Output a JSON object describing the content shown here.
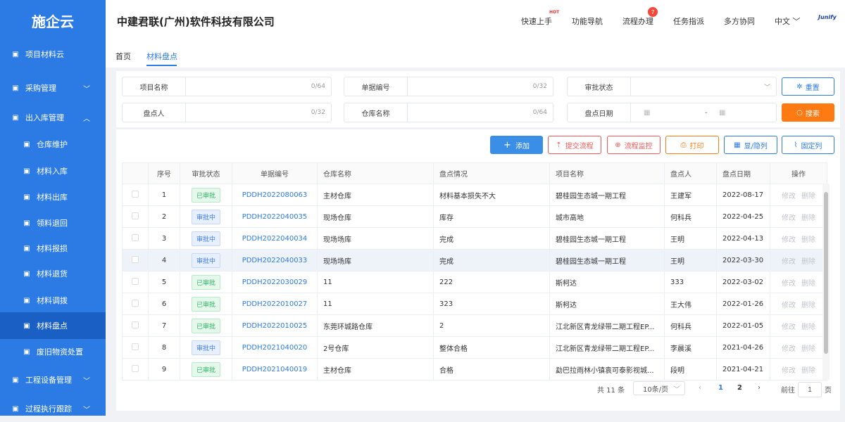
{
  "sidebar": {
    "logo": "施企云",
    "items": [
      {
        "label": "项目材料云",
        "icon": "grid-icon",
        "level": "top"
      },
      {
        "label": "采购管理",
        "icon": "people-icon",
        "level": "top",
        "chev": "﹀"
      },
      {
        "label": "出入库管理",
        "icon": "home-icon",
        "level": "top",
        "chev": "︿"
      },
      {
        "label": "仓库维护",
        "icon": "warehouse-icon",
        "level": "sub"
      },
      {
        "label": "材料入库",
        "icon": "inbound-icon",
        "level": "sub"
      },
      {
        "label": "材料出库",
        "icon": "outbound-icon",
        "level": "sub"
      },
      {
        "label": "领料退回",
        "icon": "return-icon",
        "level": "sub"
      },
      {
        "label": "材料报损",
        "icon": "damage-icon",
        "level": "sub"
      },
      {
        "label": "材料退货",
        "icon": "refund-icon",
        "level": "sub"
      },
      {
        "label": "材料调拨",
        "icon": "transfer-icon",
        "level": "sub"
      },
      {
        "label": "材料盘点",
        "icon": "inventory-icon",
        "level": "sub",
        "active": true
      },
      {
        "label": "废旧物资处置",
        "icon": "scrap-icon",
        "level": "sub"
      },
      {
        "label": "工程设备管理",
        "icon": "cube-icon",
        "level": "top",
        "chev": "﹀"
      },
      {
        "label": "过程执行跟踪",
        "icon": "track-icon",
        "level": "top",
        "chev": "﹀"
      }
    ]
  },
  "header": {
    "company": "中建君联(广州)软件科技有限公司",
    "nav": [
      "快速上手",
      "功能导航",
      "流程办理",
      "任务指派",
      "多方协同",
      "中文"
    ],
    "hot_label": "HOT",
    "process_badge": "7",
    "brand": "Junify"
  },
  "tabs": [
    "首页",
    "材料盘点"
  ],
  "filter": {
    "project_name": {
      "label": "项目名称",
      "count": "0/64"
    },
    "doc_no": {
      "label": "单据编号",
      "count": "0/32"
    },
    "approve_status": {
      "label": "审批状态"
    },
    "counter": {
      "label": "盘点人",
      "count": "0/32"
    },
    "warehouse": {
      "label": "仓库名称",
      "count": "0/64"
    },
    "date": {
      "label": "盘点日期",
      "sep": "-"
    },
    "reset": "重置",
    "search": "搜索"
  },
  "toolbar": {
    "add": "添加",
    "submit": "提交流程",
    "monitor": "流程监控",
    "print": "打印",
    "toggle_cols": "显/隐列",
    "pin_cols": "固定列"
  },
  "table": {
    "headers": [
      "序号",
      "审批状态",
      "单据编号",
      "仓库名称",
      "盘点情况",
      "项目名称",
      "盘点人",
      "盘点日期",
      "操作"
    ],
    "edit": "修改",
    "delete": "删除",
    "rows": [
      {
        "no": "1",
        "status": "已审批",
        "doc": "PDDH2022080063",
        "wh": "主材仓库",
        "cond": "材料基本损失不大",
        "proj": "碧桂园生态城一期工程",
        "person": "王建军",
        "date": "2022-08-17"
      },
      {
        "no": "2",
        "status": "审批中",
        "doc": "PDDH2022040035",
        "wh": "现场仓库",
        "cond": "库存",
        "proj": "城市高地",
        "person": "何科兵",
        "date": "2022-04-25"
      },
      {
        "no": "3",
        "status": "审批中",
        "doc": "PDDH2022040034",
        "wh": "现场场库",
        "cond": "完成",
        "proj": "碧桂园生态城一期工程",
        "person": "王明",
        "date": "2022-04-13"
      },
      {
        "no": "4",
        "status": "审批中",
        "doc": "PDDH2022040033",
        "wh": "现场场库",
        "cond": "完成",
        "proj": "碧桂园生态城一期工程",
        "person": "王明",
        "date": "2022-03-30"
      },
      {
        "no": "5",
        "status": "已审批",
        "doc": "PDDH2022030029",
        "wh": "11",
        "cond": "222",
        "proj": "斯柯达",
        "person": "333",
        "date": "2022-03-02"
      },
      {
        "no": "6",
        "status": "已审批",
        "doc": "PDDH2022010027",
        "wh": "11",
        "cond": "323",
        "proj": "斯柯达",
        "person": "王大伟",
        "date": "2022-01-26"
      },
      {
        "no": "7",
        "status": "已审批",
        "doc": "PDDH2022010025",
        "wh": "东莞环城路仓库",
        "cond": "2",
        "proj": "江北新区青龙绿带二期工程EP...",
        "person": "何科兵",
        "date": "2022-01-05"
      },
      {
        "no": "8",
        "status": "审批中",
        "doc": "PDDH2021040020",
        "wh": "2号仓库",
        "cond": "整体合格",
        "proj": "江北新区青龙绿带二期工程EP...",
        "person": "李晨溪",
        "date": "2021-04-26"
      },
      {
        "no": "9",
        "status": "已审批",
        "doc": "PDDH2021040019",
        "wh": "主材仓库",
        "cond": "合格",
        "proj": "勐巴拉雨林小镇袁可泰影视城...",
        "person": "段明",
        "date": "2021-04-21"
      }
    ]
  },
  "pager": {
    "total": "共 11 条",
    "size": "10条/页",
    "pages": [
      "1",
      "2"
    ],
    "goto": "前往",
    "goto_value": "1",
    "page_unit": "页"
  }
}
